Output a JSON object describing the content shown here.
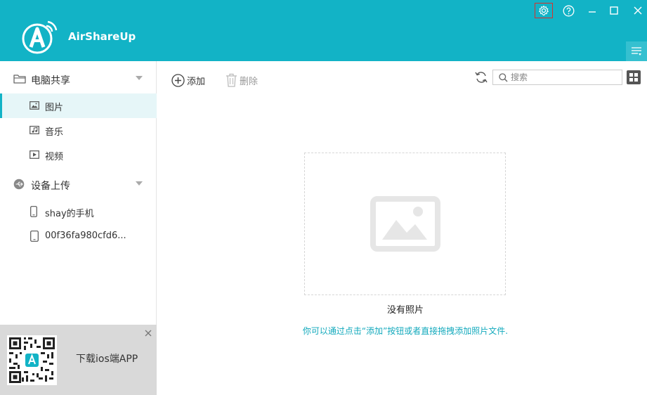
{
  "app": {
    "title": "AirShareUp"
  },
  "colors": {
    "brand": "#12b3c6",
    "hint_text": "#12a9bc",
    "settings_highlight": "#d9302c"
  },
  "window_controls": {
    "settings_icon": "gear-icon",
    "help_icon": "help-icon",
    "minimize_icon": "minimize-icon",
    "maximize_icon": "maximize-icon",
    "close_icon": "close-icon"
  },
  "sidebar": {
    "sections": [
      {
        "label": "电脑共享",
        "icon": "folder-icon",
        "items": [
          {
            "label": "图片",
            "icon": "image-icon",
            "active": true
          },
          {
            "label": "音乐",
            "icon": "music-icon",
            "active": false
          },
          {
            "label": "视频",
            "icon": "video-icon",
            "active": false
          }
        ]
      },
      {
        "label": "设备上传",
        "icon": "usb-icon",
        "items": [
          {
            "label": "shay的手机",
            "icon": "phone-icon"
          },
          {
            "label": "00f36fa980cfd6...",
            "icon": "tablet-icon"
          }
        ]
      }
    ],
    "promo": {
      "text": "下载ios端APP"
    }
  },
  "toolbar": {
    "add_label": "添加",
    "delete_label": "删除",
    "search_placeholder": "搜索"
  },
  "main": {
    "empty_title": "没有照片",
    "empty_hint": "你可以通过点击“添加”按钮或者直接拖拽添加照片文件."
  }
}
